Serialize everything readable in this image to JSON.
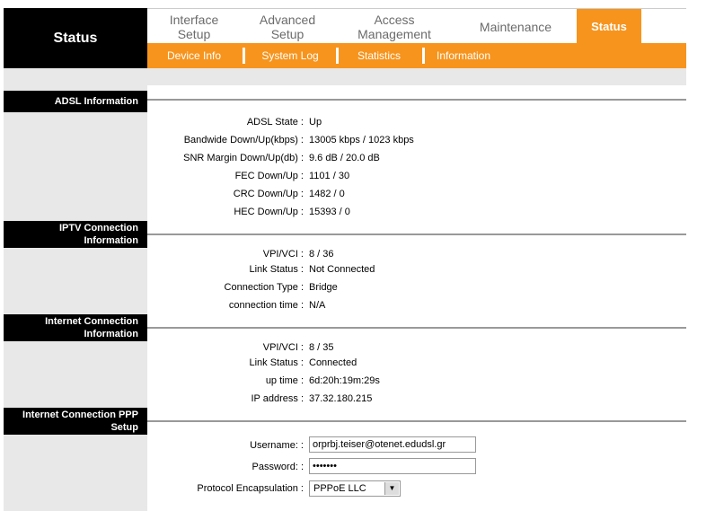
{
  "header": {
    "title": "Status",
    "tabs": [
      {
        "label": "Interface\nSetup"
      },
      {
        "label": "Advanced\nSetup"
      },
      {
        "label": "Access\nManagement"
      },
      {
        "label": "Maintenance"
      },
      {
        "label": "Status"
      }
    ],
    "subtabs": [
      {
        "label": "Device Info"
      },
      {
        "label": "System Log"
      },
      {
        "label": "Statistics"
      },
      {
        "label": "Information"
      }
    ]
  },
  "adsl": {
    "heading": "ADSL Information",
    "rows": [
      {
        "label": "ADSL State :",
        "value": "Up"
      },
      {
        "label": "Bandwide Down/Up(kbps) :",
        "value": "13005 kbps / 1023 kbps"
      },
      {
        "label": "SNR Margin Down/Up(db) :",
        "value": "9.6 dB / 20.0 dB"
      },
      {
        "label": "FEC Down/Up :",
        "value": "1101 / 30"
      },
      {
        "label": "CRC Down/Up :",
        "value": "1482 / 0"
      },
      {
        "label": "HEC Down/Up :",
        "value": "15393 / 0"
      }
    ]
  },
  "iptv": {
    "heading": "IPTV Connection\nInformation",
    "rows": [
      {
        "label": "VPI/VCI :",
        "value": "8 / 36"
      },
      {
        "label": "Link Status :",
        "value": "Not Connected"
      },
      {
        "label": "Connection Type :",
        "value": "Bridge"
      },
      {
        "label": "connection time :",
        "value": "N/A"
      }
    ]
  },
  "internet": {
    "heading": "Internet Connection\nInformation",
    "rows": [
      {
        "label": "VPI/VCI :",
        "value": "8 / 35"
      },
      {
        "label": "Link Status :",
        "value": "Connected"
      },
      {
        "label": "up time :",
        "value": "6d:20h:19m:29s"
      },
      {
        "label": "IP address :",
        "value": "37.32.180.215"
      }
    ]
  },
  "ppp": {
    "heading": "Internet Connection PPP\nSetup",
    "username_label": "Username: :",
    "username_value": "orprbj.teiser@otenet.edudsl.gr",
    "password_label": "Password: :",
    "password_value": "•••••••",
    "encap_label": "Protocol Encapsulation :",
    "encap_value": "PPPoE LLC"
  }
}
